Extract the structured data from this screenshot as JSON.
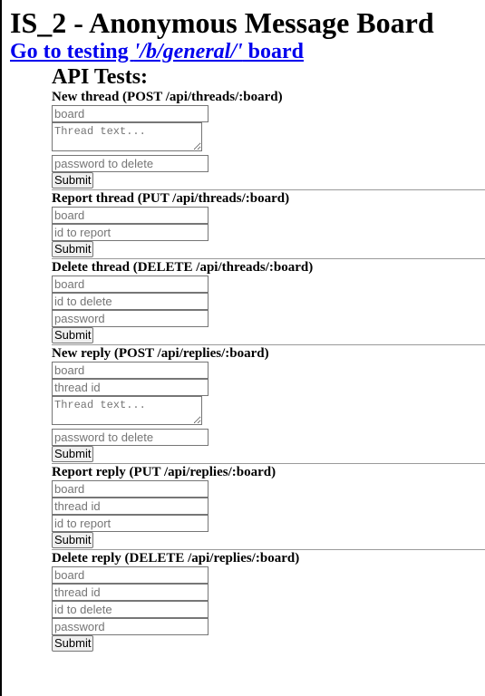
{
  "page": {
    "title": "IS_2 - Anonymous Message Board",
    "link": {
      "prefix": "Go to testing ",
      "board": "'/b/general/'",
      "suffix": " board"
    }
  },
  "api": {
    "title": "API Tests:",
    "new_thread": {
      "title": "New thread (POST /api/threads/:board)",
      "board_placeholder": "board",
      "text_placeholder": "Thread text...",
      "password_placeholder": "password to delete",
      "submit": "Submit"
    },
    "report_thread": {
      "title": "Report thread (PUT /api/threads/:board)",
      "board_placeholder": "board",
      "id_placeholder": "id to report",
      "submit": "Submit"
    },
    "delete_thread": {
      "title": "Delete thread (DELETE /api/threads/:board)",
      "board_placeholder": "board",
      "id_placeholder": "id to delete",
      "password_placeholder": "password",
      "submit": "Submit"
    },
    "new_reply": {
      "title": "New reply (POST /api/replies/:board)",
      "board_placeholder": "board",
      "thread_id_placeholder": "thread id",
      "text_placeholder": "Thread text...",
      "password_placeholder": "password to delete",
      "submit": "Submit"
    },
    "report_reply": {
      "title": "Report reply (PUT /api/replies/:board)",
      "board_placeholder": "board",
      "thread_id_placeholder": "thread id",
      "id_placeholder": "id to report",
      "submit": "Submit"
    },
    "delete_reply": {
      "title": "Delete reply (DELETE /api/replies/:board)",
      "board_placeholder": "board",
      "thread_id_placeholder": "thread id",
      "id_placeholder": "id to delete",
      "password_placeholder": "password",
      "submit": "Submit"
    }
  }
}
